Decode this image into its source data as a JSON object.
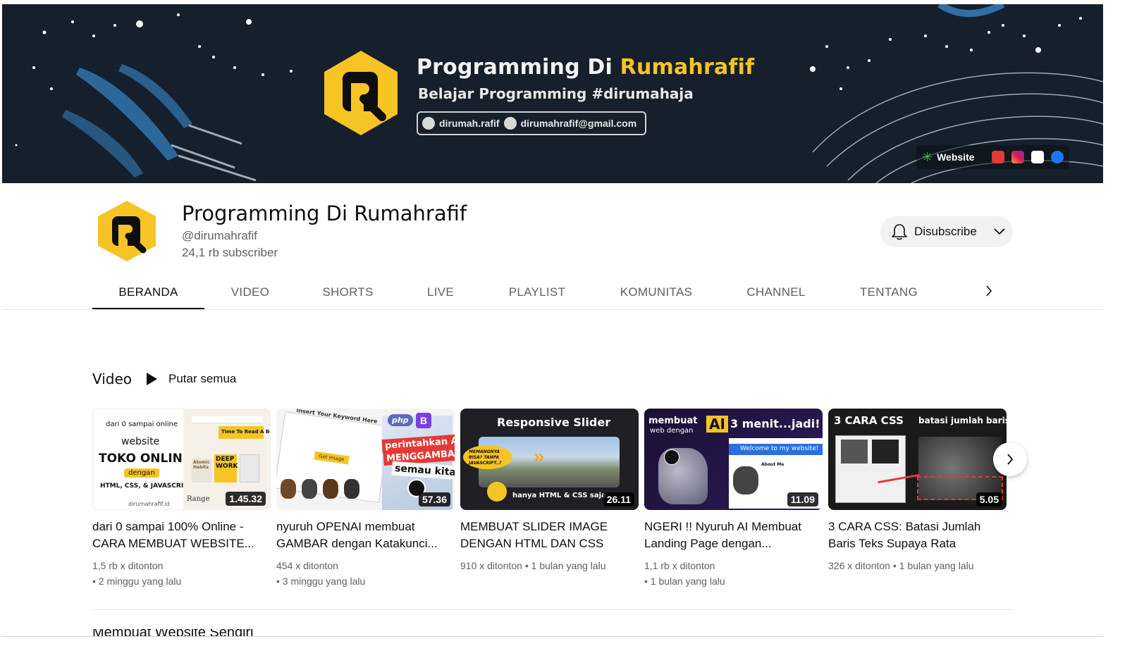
{
  "banner": {
    "title_main": "Programming Di",
    "title_accent": "Rumahrafif",
    "tagline": "Belajar Programming #dirumahaja",
    "instagram": "dirumah.rafif",
    "email": "dirumahrafif@gmail.com",
    "website_label": "Website"
  },
  "channel": {
    "name": "Programming Di Rumahrafif",
    "handle": "@dirumahrafif",
    "subscribers": "24,1 rb subscriber",
    "subscribe_label": "Disubscribe"
  },
  "tabs": [
    "BERANDA",
    "VIDEO",
    "SHORTS",
    "LIVE",
    "PLAYLIST",
    "KOMUNITAS",
    "CHANNEL",
    "TENTANG"
  ],
  "shelf": {
    "title": "Video",
    "play_all": "Putar semua",
    "next_shelf_title": "Membuat Website Sendiri"
  },
  "videos": [
    {
      "title": "dari 0 sampai 100% Online - CARA MEMBUAT WEBSITE...",
      "views": "1,5 rb x ditonton",
      "age": "• 2 minggu yang lalu",
      "duration": "1.45.32",
      "thumb": {
        "line1": "dari 0 sampai online",
        "line2": "website",
        "line3": "TOKO ONLINE",
        "line4": "dengan",
        "line5": "HTML, CSS, & JAVASCRIPT",
        "line6": "dirumahrafif.id",
        "book1": "DEEP WORK",
        "book2": "Range",
        "book3": "Atomic Habits",
        "book4": "Time To Read A Book"
      }
    },
    {
      "title": "nyuruh OPENAI membuat GAMBAR dengan Katakunci...",
      "views": "454 x ditonton",
      "age": "• 3 minggu yang lalu",
      "duration": "57.36",
      "thumb": {
        "line1": "Insert Your Keyword Here",
        "line2": "perintahkan AI",
        "line3": "MENGGAMBAR",
        "line4": "semau kita",
        "line5": "Get Image",
        "badge1": "php"
      }
    },
    {
      "title": "MEMBUAT SLIDER IMAGE DENGAN HTML DAN CSS",
      "views": "910 x ditonton",
      "age": "• 1 bulan yang lalu",
      "duration": "26.11",
      "thumb": {
        "line1": "Responsive Slider",
        "line2": "MEMANGNYA BISA? TANPA JAVASCRIPT..?",
        "line3": "hanya HTML & CSS saja"
      }
    },
    {
      "title": "NGERI !! Nyuruh AI Membuat Landing Page dengan...",
      "views": "1,1 rb x ditonton",
      "age": "• 1 bulan yang lalu",
      "duration": "11.09",
      "thumb": {
        "line1": "membuat",
        "line2": "web dengan",
        "line3": "AI",
        "line4": "3 menit...jadi!",
        "line5": "Welcome to my website!",
        "line6": "About Me"
      }
    },
    {
      "title": "3 CARA CSS: Batasi Jumlah Baris Teks Supaya Rata",
      "views": "326 x ditonton",
      "age": "• 1 bulan yang lalu",
      "duration": "5.05",
      "thumb": {
        "line1": "3 CARA CSS",
        "line2": "batasi jumlah baris"
      }
    }
  ],
  "colors": {
    "banner_bg": "#16202c",
    "brand_yellow": "#f7c425",
    "accent_red": "#e53935"
  }
}
